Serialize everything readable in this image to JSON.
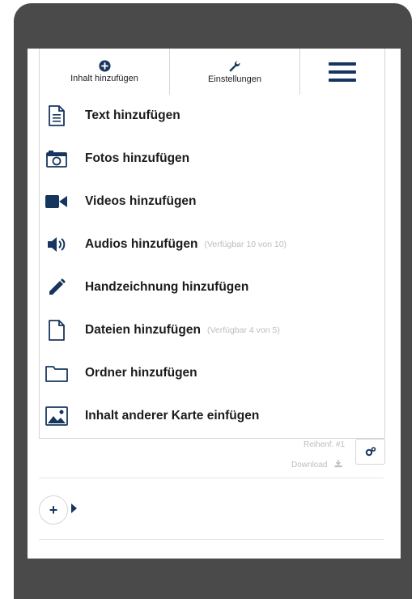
{
  "toolbar": {
    "add_content_label": "Inhalt hinzufügen",
    "settings_label": "Einstellungen"
  },
  "menu": {
    "items": [
      {
        "label": "Text hinzufügen",
        "note": "",
        "icon": "text-document-icon"
      },
      {
        "label": "Fotos hinzufügen",
        "note": "",
        "icon": "camera-icon"
      },
      {
        "label": "Videos hinzufügen",
        "note": "",
        "icon": "video-camera-icon"
      },
      {
        "label": "Audios hinzufügen",
        "note": "(Verfügbar 10 von 10)",
        "icon": "speaker-icon"
      },
      {
        "label": "Handzeichnung hinzufügen",
        "note": "",
        "icon": "pencil-icon"
      },
      {
        "label": "Dateien hinzufügen",
        "note": "(Verfügbar 4 von 5)",
        "icon": "file-icon"
      },
      {
        "label": "Ordner hinzufügen",
        "note": "",
        "icon": "folder-icon"
      },
      {
        "label": "Inhalt anderer Karte einfügen",
        "note": "",
        "icon": "image-icon"
      }
    ]
  },
  "card_meta": {
    "order_label": "Reihenf. #1",
    "download_label": "Download"
  },
  "add_button": {
    "label": "+"
  },
  "colors": {
    "brand": "#17365e",
    "text": "#1b1b1b",
    "muted": "#bdbdbd",
    "border": "#d6d6d6",
    "frame": "#4a4a4a"
  }
}
